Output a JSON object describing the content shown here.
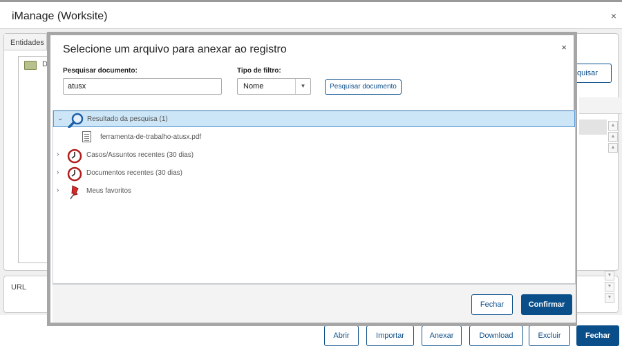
{
  "window": {
    "title": "iManage (Worksite)",
    "close_glyph": "×"
  },
  "entities": {
    "tab_label": "Entidades",
    "folder_label": "D",
    "search_button_fragment": "quisar"
  },
  "url_panel": {
    "label": "URL"
  },
  "footer_buttons": {
    "abrir": "Abrir",
    "importar": "Importar",
    "anexar": "Anexar",
    "download": "Download",
    "excluir": "Excluir",
    "fechar": "Fechar"
  },
  "modal": {
    "title": "Selecione um arquivo para anexar ao registro",
    "close_glyph": "×",
    "search_label": "Pesquisar documento:",
    "search_value": "atusx",
    "filter_label": "Tipo de filtro:",
    "filter_value": "Nome",
    "search_button": "Pesquisar documento",
    "tree": {
      "search_results": "Resultado da pesquisa (1)",
      "result_file": "ferramenta-de-trabalho-atusx.pdf",
      "recent_cases": "Casos/Assuntos recentes (30 dias)",
      "recent_docs": "Documentos recentes (30 dias)",
      "favorites": "Meus favoritos"
    },
    "buttons": {
      "close": "Fechar",
      "confirm": "Confirmar"
    }
  },
  "icons": {
    "search_results": "magnifier-icon",
    "recent_cases": "clock-icon",
    "recent_docs": "clock-icon",
    "favorites": "pushpin-icon",
    "file": "document-icon",
    "folder": "folder-icon"
  },
  "colors": {
    "primary": "#0b4f8a",
    "selected_row": "#cde6f7",
    "selected_border": "#5b9bd5"
  }
}
